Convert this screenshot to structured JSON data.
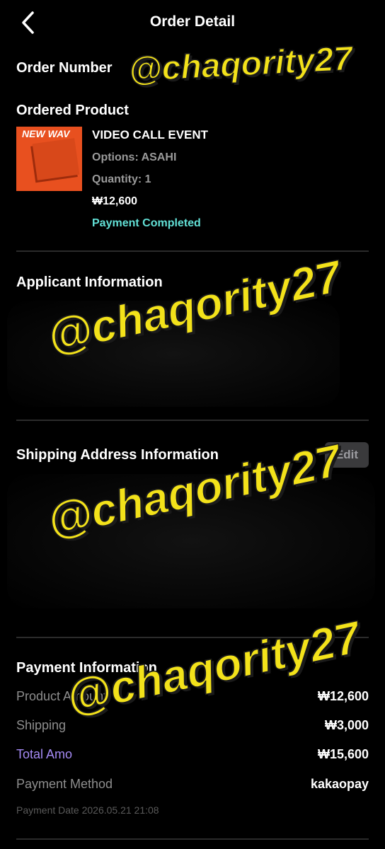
{
  "header": {
    "title": "Order Detail",
    "back_icon": "chevron-left-icon"
  },
  "order": {
    "number_label": "Order Number",
    "number_value": ""
  },
  "ordered_product": {
    "section_label": "Ordered Product",
    "thumbnail_text": "NEW WAV",
    "name": "VIDEO CALL EVENT",
    "options": "Options: ASAHI",
    "quantity": "Quantity: 1",
    "price": "₩12,600",
    "status": "Payment Completed",
    "status_color": "#62e0d6"
  },
  "applicant": {
    "section_label": "Applicant Information"
  },
  "shipping": {
    "section_label": "Shipping Address Information",
    "edit_label": "Edit"
  },
  "payment": {
    "section_label": "Payment Information",
    "rows": [
      {
        "label": "Product Amount",
        "value": "₩12,600"
      },
      {
        "label": "Shipping",
        "value": "₩3,000"
      },
      {
        "label": "Total Amo",
        "value": "₩15,600"
      },
      {
        "label": "Payment Method",
        "value": "kakaopay"
      }
    ],
    "date": "Payment Date 2026.05.21 21:08",
    "total_color": "#a58af5"
  },
  "watermark": {
    "text": "@chaqority27",
    "color": "#f3e21a"
  }
}
